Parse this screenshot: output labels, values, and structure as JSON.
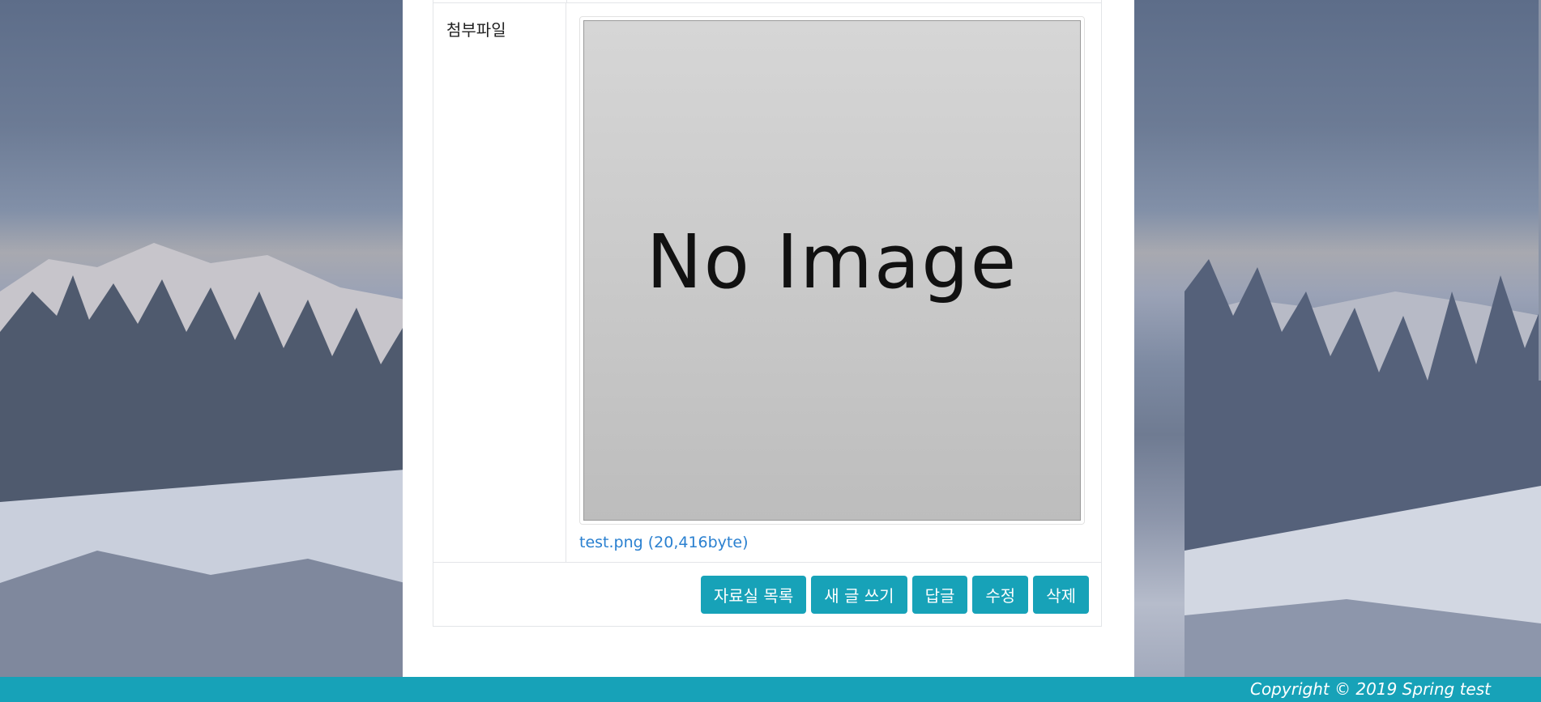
{
  "attachment": {
    "label": "첨부파일",
    "preview_text": "No Image",
    "file_link": "test.png (20,416byte)"
  },
  "buttons": {
    "list": "자료실 목록",
    "new_post": "새 글 쓰기",
    "reply": "답글",
    "edit": "수정",
    "delete": "삭제"
  },
  "footer": {
    "copyright": "Copyright © 2019 Spring test"
  },
  "colors": {
    "accent": "#17a2b8",
    "link": "#2a80d0"
  }
}
